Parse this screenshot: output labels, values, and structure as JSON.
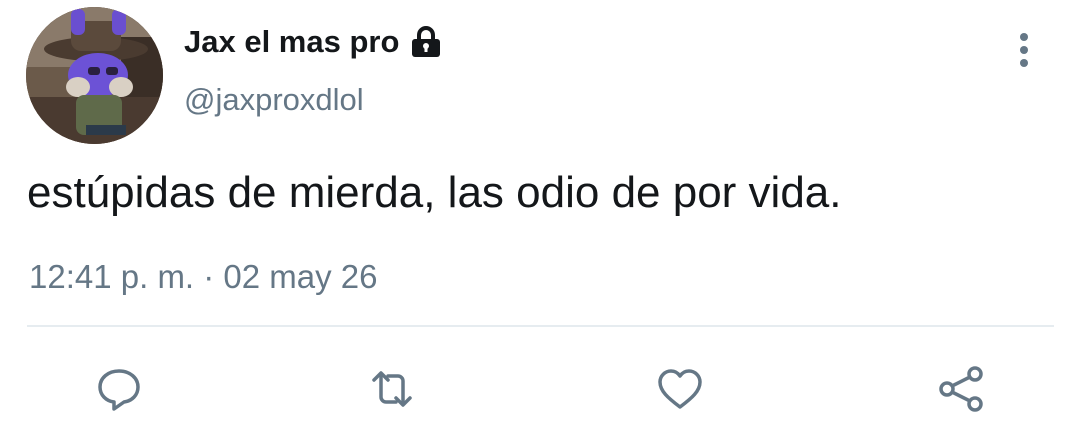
{
  "tweet": {
    "author": {
      "display_name": "Jax el mas pro",
      "handle": "@jaxproxdlol",
      "protected_icon": "lock-icon",
      "avatar": "avatar"
    },
    "text": "estúpidas de mierda, las odio de por vida.",
    "timestamp": "12:41 p. m. · 02 may 26",
    "menu_icon": "more-vertical-icon",
    "actions": [
      {
        "name": "reply",
        "icon": "reply-icon"
      },
      {
        "name": "retweet",
        "icon": "retweet-icon"
      },
      {
        "name": "like",
        "icon": "like-icon"
      },
      {
        "name": "share",
        "icon": "share-icon"
      }
    ]
  },
  "colors": {
    "text_primary": "#14171a",
    "text_secondary": "#657786",
    "icon": "#657786",
    "divider": "#e6ecf0"
  }
}
